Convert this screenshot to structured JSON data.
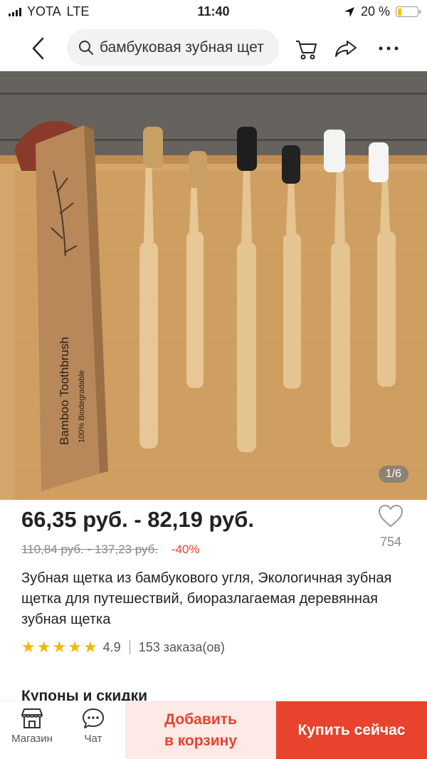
{
  "status_bar": {
    "carrier": "YOTA",
    "network": "LTE",
    "time": "11:40",
    "battery": "20 %",
    "battery_color": "#f5c400"
  },
  "nav": {
    "search_text": "бамбуковая зубная щет",
    "icons": [
      "back-icon",
      "search-icon",
      "cart-icon",
      "share-icon",
      "more-icon"
    ]
  },
  "gallery": {
    "counter": "1/6",
    "package_label": "Bamboo Toothbrush",
    "package_sublabel": "100% Biodegradable"
  },
  "product": {
    "price": "66,35 руб. - 82,19 руб.",
    "old_price": "110,84 руб. - 137,23 руб.",
    "discount": "-40%",
    "wishlist_count": "754",
    "title": "Зубная щетка из бамбукового угля, Экологичная зубная щетка для путешествий, биоразлагаемая деревянная зубная щетка",
    "rating": "4.9",
    "rating_stars": 5,
    "orders": "153 заказа(ов)",
    "accent_color": "#e8432c"
  },
  "sections": {
    "coupons": "Купоны и скидки"
  },
  "bottom_bar": {
    "store": "Магазин",
    "chat": "Чат",
    "add_to_cart": "Добавить\nв корзину",
    "buy_now": "Купить сейчас"
  }
}
